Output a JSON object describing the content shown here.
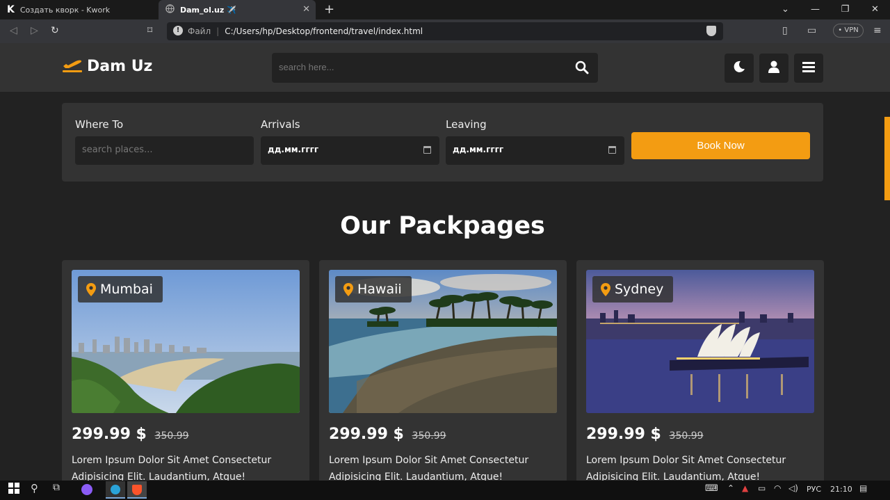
{
  "browser": {
    "tabs": [
      {
        "title": "Создать кворк - Kwork",
        "active": false
      },
      {
        "title": "Dam_ol.uz ✈️",
        "active": true
      }
    ],
    "address": {
      "label": "Файл",
      "separator": "|",
      "url": "C:/Users/hp/Desktop/frontend/travel/index.html"
    },
    "vpn_label": "• VPN"
  },
  "site": {
    "logo_text": "Dam Uz",
    "search_placeholder": "search here...",
    "accent_color": "#f39c12",
    "booking": {
      "where_label": "Where To",
      "where_placeholder": "search places...",
      "arrivals_label": "Arrivals",
      "arrivals_value": "дд.мм.гггг",
      "leaving_label": "Leaving",
      "leaving_value": "дд.мм.гггг",
      "button_label": "Book Now"
    },
    "heading": {
      "part1": "Our",
      "part2": "Packpages"
    },
    "packages": [
      {
        "place": "Mumbai",
        "price": "299.99 $",
        "old_price": "350.99",
        "desc": "Lorem Ipsum Dolor Sit Amet Consectetur Adipisicing Elit. Laudantium, Atque!"
      },
      {
        "place": "Hawaii",
        "price": "299.99 $",
        "old_price": "350.99",
        "desc": "Lorem Ipsum Dolor Sit Amet Consectetur Adipisicing Elit. Laudantium, Atque!"
      },
      {
        "place": "Sydney",
        "price": "299.99 $",
        "old_price": "350.99",
        "desc": "Lorem Ipsum Dolor Sit Amet Consectetur Adipisicing Elit. Laudantium, Atque!"
      }
    ]
  },
  "taskbar": {
    "lang": "РУС",
    "time": "21:10"
  }
}
